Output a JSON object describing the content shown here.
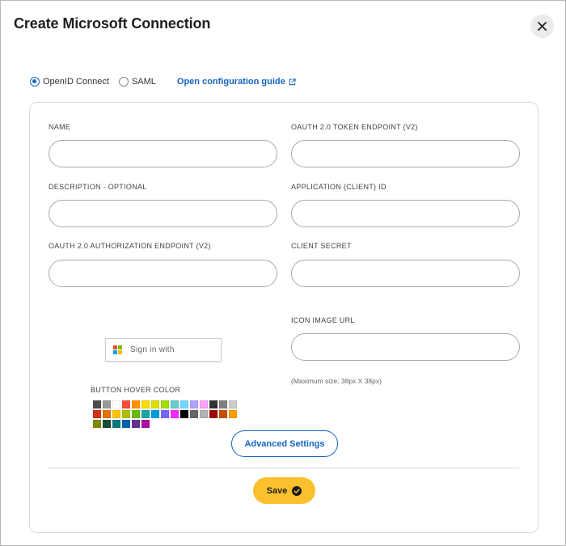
{
  "dialog": {
    "title": "Create Microsoft Connection",
    "close_icon": "close-icon"
  },
  "protocol": {
    "options": [
      {
        "label": "OpenID Connect",
        "selected": true
      },
      {
        "label": "SAML",
        "selected": false
      }
    ],
    "guide_link": "Open configuration guide",
    "guide_icon": "external-link-icon",
    "accent_color": "#1565c0"
  },
  "form": {
    "name": {
      "label": "NAME",
      "value": "",
      "placeholder": ""
    },
    "description": {
      "label": "DESCRIPTION - OPTIONAL",
      "value": "",
      "placeholder": ""
    },
    "auth_endpoint": {
      "label": "OAUTH 2.0 AUTHORIZATION ENDPOINT (V2)",
      "value": "",
      "placeholder": ""
    },
    "token_endpoint": {
      "label": "OAUTH 2.0 TOKEN ENDPOINT (V2)",
      "value": "",
      "placeholder": ""
    },
    "client_id": {
      "label": "APPLICATION (CLIENT) ID",
      "value": "",
      "placeholder": ""
    },
    "client_secret": {
      "label": "CLIENT SECRET",
      "value": "",
      "placeholder": ""
    },
    "icon_url": {
      "label": "ICON IMAGE URL",
      "value": "",
      "placeholder": "",
      "hint": "(Maximum size: 38px X 38px)"
    }
  },
  "preview": {
    "signin_text": "Sign in with",
    "logo_icon": "microsoft-logo-icon",
    "logo_colors": [
      "#f25022",
      "#7fba00",
      "#00a4ef",
      "#ffb900"
    ]
  },
  "hover_color": {
    "label": "BUTTON HOVER COLOR",
    "swatches": [
      "#4d4d4d",
      "#999999",
      "#ffffff",
      "#f44e3b",
      "#fe9200",
      "#fcdc00",
      "#dbdf00",
      "#a4dd00",
      "#68ccca",
      "#73d8ff",
      "#aea1ff",
      "#fda1ff",
      "#333333",
      "#808080",
      "#cccccc",
      "#d33115",
      "#e27300",
      "#fcc400",
      "#b0bc00",
      "#68bc00",
      "#16a5a5",
      "#009ce0",
      "#7b64ff",
      "#fa28ff",
      "#000000",
      "#666666",
      "#b3b3b3",
      "#9f0500",
      "#c45100",
      "#fb9e00",
      "#808900",
      "#194d33",
      "#0c797d",
      "#0062b1",
      "#653294",
      "#ab149e"
    ]
  },
  "actions": {
    "advanced_label": "Advanced Settings",
    "save_label": "Save",
    "save_icon": "check-circle-icon",
    "save_color": "#fbc02d"
  }
}
